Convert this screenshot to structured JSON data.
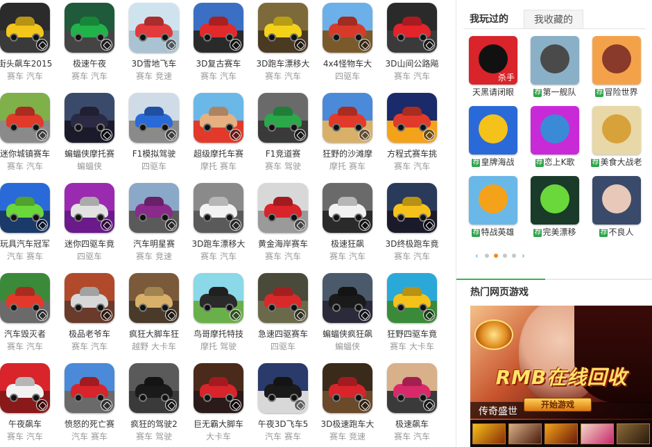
{
  "games": [
    {
      "name": "街头飙车2015",
      "tags": [
        "赛车",
        "汽车"
      ],
      "colors": [
        "#2b2b2b",
        "#f4c51a",
        "#3a3a3a"
      ]
    },
    {
      "name": "极速午夜",
      "tags": [
        "赛车",
        "汽车"
      ],
      "colors": [
        "#1f5a3a",
        "#1fb34a",
        "#444"
      ]
    },
    {
      "name": "3D雪地飞车",
      "tags": [
        "赛车",
        "竞速"
      ],
      "colors": [
        "#cfe3ee",
        "#e33b3b",
        "#a9c3d3"
      ]
    },
    {
      "name": "3D复古赛车",
      "tags": [
        "赛车",
        "汽车"
      ],
      "colors": [
        "#3a6fc4",
        "#e22a2a",
        "#2a2a2a"
      ]
    },
    {
      "name": "3D跑车漂移大",
      "tags": [
        "赛车",
        "汽车"
      ],
      "colors": [
        "#7c6a3a",
        "#f4d21a",
        "#4a3a22"
      ]
    },
    {
      "name": "4x4怪物车大",
      "tags": [
        "四驱车"
      ],
      "colors": [
        "#6bb0e8",
        "#d83a2a",
        "#7a5a2a"
      ]
    },
    {
      "name": "3D山间公路飚",
      "tags": [
        "赛车",
        "汽车"
      ],
      "colors": [
        "#2a2a2a",
        "#e3242a",
        "#3a3a3a"
      ]
    },
    {
      "name": "迷你城镇赛车",
      "tags": [
        "赛车",
        "汽车"
      ],
      "colors": [
        "#7fb04a",
        "#e23a2a",
        "#8a8a8a"
      ]
    },
    {
      "name": "蝙蝠侠摩托赛",
      "tags": [
        "蝙蝠侠"
      ],
      "colors": [
        "#3a4a6a",
        "#2a2a44",
        "#1a1a2a"
      ]
    },
    {
      "name": "F1模拟驾驶",
      "tags": [
        "四驱车"
      ],
      "colors": [
        "#cfdbe6",
        "#2a6ad8",
        "#8a8a8a"
      ]
    },
    {
      "name": "超级摩托车赛",
      "tags": [
        "摩托",
        "赛车"
      ],
      "colors": [
        "#6ab8e8",
        "#e8b080",
        "#e23a2a"
      ]
    },
    {
      "name": "F1竞道赛",
      "tags": [
        "赛车",
        "驾驶"
      ],
      "colors": [
        "#6a6a6a",
        "#2aa84a",
        "#3a3a3a"
      ]
    },
    {
      "name": "狂野的沙滩摩",
      "tags": [
        "摩托",
        "赛车"
      ],
      "colors": [
        "#4a8ad8",
        "#e23a2a",
        "#d8b06a"
      ]
    },
    {
      "name": "方程式赛车挑",
      "tags": [
        "赛车",
        "汽车"
      ],
      "colors": [
        "#1a2a6a",
        "#e23a2a",
        "#f4a21a"
      ]
    },
    {
      "name": "玩具汽车冠军",
      "tags": [
        "汽车",
        "赛车"
      ],
      "colors": [
        "#2a6ad8",
        "#6ad83a",
        "#1a3a6a"
      ]
    },
    {
      "name": "迷你四驱车竟",
      "tags": [
        "四驱车"
      ],
      "colors": [
        "#9a2ab0",
        "#e2e2e2",
        "#6a1a8a"
      ]
    },
    {
      "name": "汽车明星赛",
      "tags": [
        "赛车",
        "竞速"
      ],
      "colors": [
        "#8aa8c8",
        "#8a2a8a",
        "#5a5a5a"
      ]
    },
    {
      "name": "3D跑车漂移大",
      "tags": [
        "赛车",
        "汽车"
      ],
      "colors": [
        "#8a8a8a",
        "#f2f2f2",
        "#5a5a5a"
      ]
    },
    {
      "name": "黄金海岸赛车",
      "tags": [
        "赛车",
        "汽车"
      ],
      "colors": [
        "#d8d8d8",
        "#d8242a",
        "#9a9a9a"
      ]
    },
    {
      "name": "极速狂飙",
      "tags": [
        "赛车",
        "汽车"
      ],
      "colors": [
        "#6a6a6a",
        "#f2f2f2",
        "#2a2a2a"
      ]
    },
    {
      "name": "3D终极跑车竟",
      "tags": [
        "赛车",
        "汽车"
      ],
      "colors": [
        "#2a3a5a",
        "#f4c21a",
        "#1a1a2a"
      ]
    },
    {
      "name": "汽车毁灭者",
      "tags": [
        "赛车",
        "汽车"
      ],
      "colors": [
        "#3a8a3a",
        "#e23a2a",
        "#6a6a6a"
      ]
    },
    {
      "name": "极品老爷车",
      "tags": [
        "赛车",
        "汽车"
      ],
      "colors": [
        "#b04a2a",
        "#d8d8d8",
        "#6a3a2a"
      ]
    },
    {
      "name": "疯狂大脚车狂",
      "tags": [
        "越野",
        "大卡车"
      ],
      "colors": [
        "#7a5a3a",
        "#d8b06a",
        "#4a3a2a"
      ]
    },
    {
      "name": "鸟哥摩托特技",
      "tags": [
        "摩托",
        "驾驶"
      ],
      "colors": [
        "#8ad8e8",
        "#2a2a2a",
        "#6ab04a"
      ]
    },
    {
      "name": "急速四驱赛车",
      "tags": [
        "四驱车"
      ],
      "colors": [
        "#4a4a3a",
        "#d82a2a",
        "#6a6a4a"
      ]
    },
    {
      "name": "蝙蝠侠疯狂飙",
      "tags": [
        "蝙蝠侠"
      ],
      "colors": [
        "#4a5a6a",
        "#1a1a1a",
        "#2a2a3a"
      ]
    },
    {
      "name": "狂野四驱车竟",
      "tags": [
        "赛车",
        "大卡车"
      ],
      "colors": [
        "#2aa8d8",
        "#f4c21a",
        "#3a8a3a"
      ]
    },
    {
      "name": "午夜飙车",
      "tags": [
        "赛车",
        "汽车"
      ],
      "colors": [
        "#d8242a",
        "#f2f2f2",
        "#8a1a1a"
      ]
    },
    {
      "name": "愤怒的死亡赛",
      "tags": [
        "汽车",
        "赛车"
      ],
      "colors": [
        "#4a8ad8",
        "#d8242a",
        "#6a6a6a"
      ]
    },
    {
      "name": "疯狂的驾驶2",
      "tags": [
        "赛车",
        "驾驶"
      ],
      "colors": [
        "#5a5a5a",
        "#1a1a1a",
        "#3a3a3a"
      ]
    },
    {
      "name": "巨无霸大脚车",
      "tags": [
        "大卡车"
      ],
      "colors": [
        "#4a2a1a",
        "#d8242a",
        "#2a1a1a"
      ]
    },
    {
      "name": "午夜3D飞车5",
      "tags": [
        "汽车",
        "赛车"
      ],
      "colors": [
        "#2a3a6a",
        "#1a1a1a",
        "#d8d8d8"
      ]
    },
    {
      "name": "3D极速跑车大",
      "tags": [
        "赛车",
        "竞速"
      ],
      "colors": [
        "#3a2a1a",
        "#d8242a",
        "#6a4a2a"
      ]
    },
    {
      "name": "极速飙车",
      "tags": [
        "赛车",
        "汽车"
      ],
      "colors": [
        "#d8b08a",
        "#d82a6a",
        "#3a3a3a"
      ]
    }
  ],
  "sidebar": {
    "tabs": [
      "我玩过的",
      "我收藏的"
    ],
    "rec_badge": "荐",
    "played": [
      {
        "name": "天黑请闭眼",
        "rec": false,
        "caption": "杀手",
        "colors": [
          "#d8242a",
          "#111111"
        ]
      },
      {
        "name": "第一舰队",
        "rec": true,
        "caption": "",
        "colors": [
          "#8ab0c8",
          "#4a4a4a"
        ]
      },
      {
        "name": "冒险世界",
        "rec": true,
        "caption": "",
        "colors": [
          "#f4a24a",
          "#8a3a2a"
        ]
      },
      {
        "name": "皇牌海战",
        "rec": true,
        "caption": "",
        "colors": [
          "#2a6ad8",
          "#f4c21a"
        ]
      },
      {
        "name": "恋上K歌",
        "rec": true,
        "caption": "",
        "colors": [
          "#c82ad8",
          "#3a8ad8"
        ]
      },
      {
        "name": "美食大战老",
        "rec": true,
        "caption": "",
        "colors": [
          "#e8d8a8",
          "#d8a23a"
        ]
      },
      {
        "name": "特战英雄",
        "rec": true,
        "caption": "",
        "colors": [
          "#6ab8e8",
          "#f4a21a"
        ]
      },
      {
        "name": "完美漂移",
        "rec": true,
        "caption": "",
        "colors": [
          "#1a3a2a",
          "#6ad83a"
        ]
      },
      {
        "name": "不良人",
        "rec": true,
        "caption": "",
        "colors": [
          "#3a4a6a",
          "#e8c8b8"
        ]
      }
    ],
    "pager": {
      "left_arrow": "‹",
      "right_arrow": "›",
      "dots": 4,
      "active": 1
    },
    "hot_title": "热门网页游戏",
    "banner": {
      "headline": "RMB在线回收",
      "button": "开始游戏",
      "caption": "传奇盛世"
    }
  }
}
